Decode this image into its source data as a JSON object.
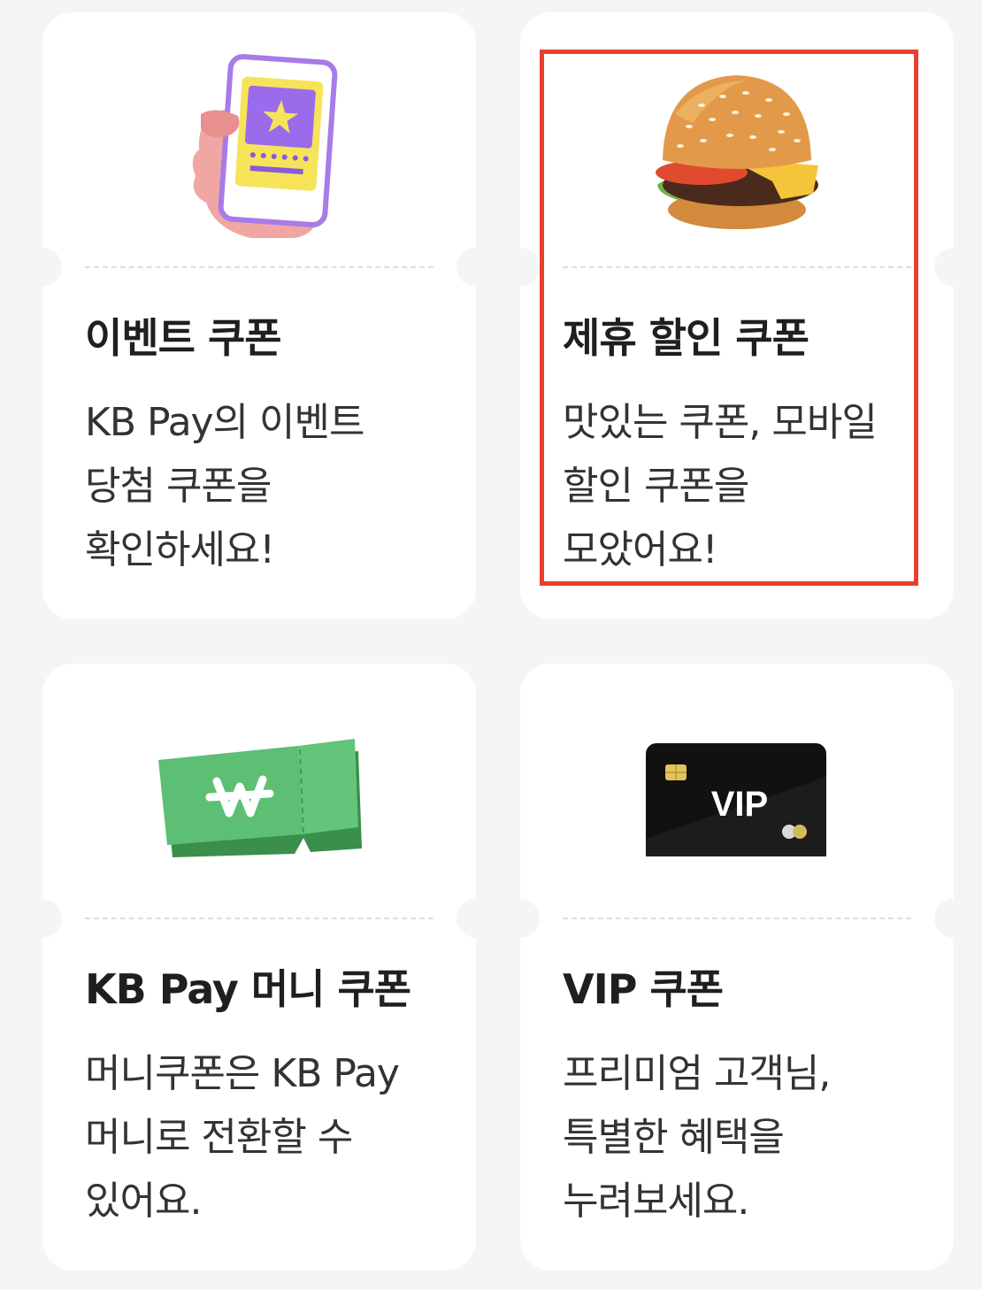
{
  "coupons": [
    {
      "id": "event",
      "title": "이벤트 쿠폰",
      "description": "KB Pay의 이벤트\n당첨 쿠폰을\n확인하세요!",
      "icon": "phone-ticket-icon"
    },
    {
      "id": "partner",
      "title": "제휴 할인 쿠폰",
      "description": "맛있는 쿠폰, 모바일\n할인 쿠폰을\n모았어요!",
      "icon": "burger-icon",
      "highlighted": true
    },
    {
      "id": "money",
      "title": "KB Pay 머니 쿠폰",
      "description": "머니쿠폰은 KB Pay\n머니로 전환할 수\n있어요.",
      "icon": "won-ticket-icon"
    },
    {
      "id": "vip",
      "title": "VIP 쿠폰",
      "description": "프리미엄 고객님,\n특별한 혜택을\n누려보세요.",
      "icon": "vip-card-icon",
      "card_label": "VIP"
    }
  ],
  "colors": {
    "background": "#f4f5f7",
    "card": "#ffffff",
    "highlight_border": "#e8402e",
    "ticket_green": "#5cbf73",
    "vip_card": "#111111"
  }
}
